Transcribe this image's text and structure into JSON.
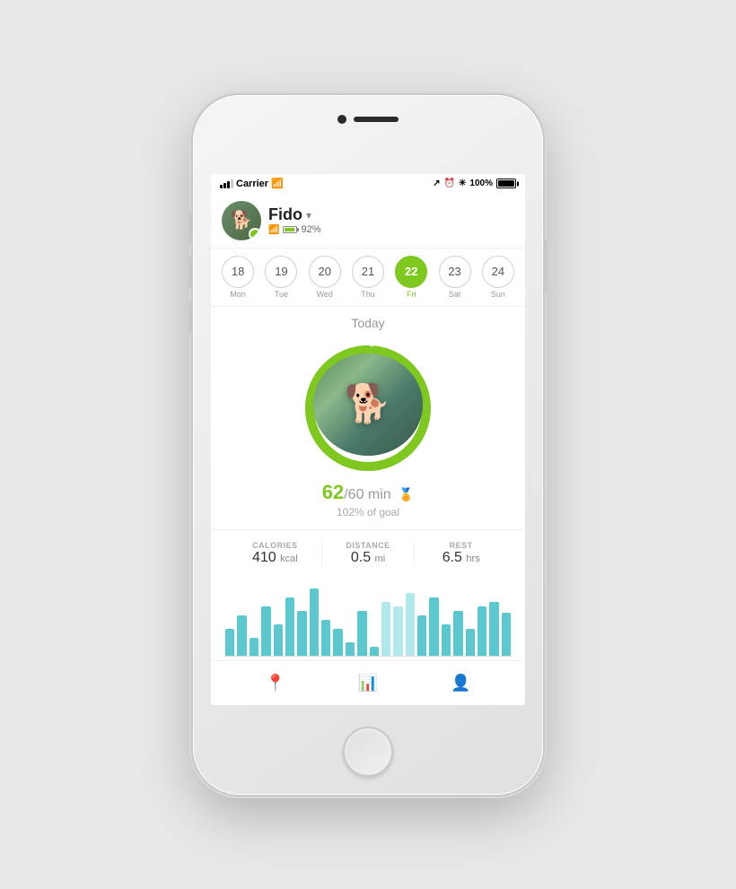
{
  "phone": {
    "status_bar": {
      "carrier": "Carrier",
      "battery_percent": "100%"
    },
    "header": {
      "dog_name": "Fido",
      "battery_level": "92%"
    },
    "dates": [
      {
        "num": "18",
        "day": "Mon",
        "state": "normal"
      },
      {
        "num": "19",
        "day": "Tue",
        "state": "normal"
      },
      {
        "num": "20",
        "day": "Wed",
        "state": "normal"
      },
      {
        "num": "21",
        "day": "Thu",
        "state": "normal"
      },
      {
        "num": "22",
        "day": "Fri",
        "state": "today"
      },
      {
        "num": "23",
        "day": "Sat",
        "state": "normal"
      },
      {
        "num": "24",
        "day": "Sun",
        "state": "normal"
      }
    ],
    "today_label": "Today",
    "activity": {
      "minutes_done": "62",
      "minutes_goal": "60",
      "unit": "min",
      "goal_percent": "102% of goal"
    },
    "stats": [
      {
        "label": "CALORIES",
        "value": "410",
        "unit": "kcal"
      },
      {
        "label": "DISTANCE",
        "value": "0.5",
        "unit": "mi"
      },
      {
        "label": "REST",
        "value": "6.5",
        "unit": "hrs"
      }
    ],
    "chart": {
      "bars": [
        30,
        45,
        20,
        55,
        35,
        65,
        50,
        75,
        40,
        30,
        15,
        50,
        10,
        60,
        55,
        70,
        45,
        65,
        35,
        50,
        30,
        55,
        60,
        48
      ]
    },
    "nav": [
      {
        "icon": "📍",
        "label": "location",
        "active": false
      },
      {
        "icon": "📊",
        "label": "activity",
        "active": true
      },
      {
        "icon": "👤",
        "label": "profile",
        "active": false
      }
    ]
  }
}
